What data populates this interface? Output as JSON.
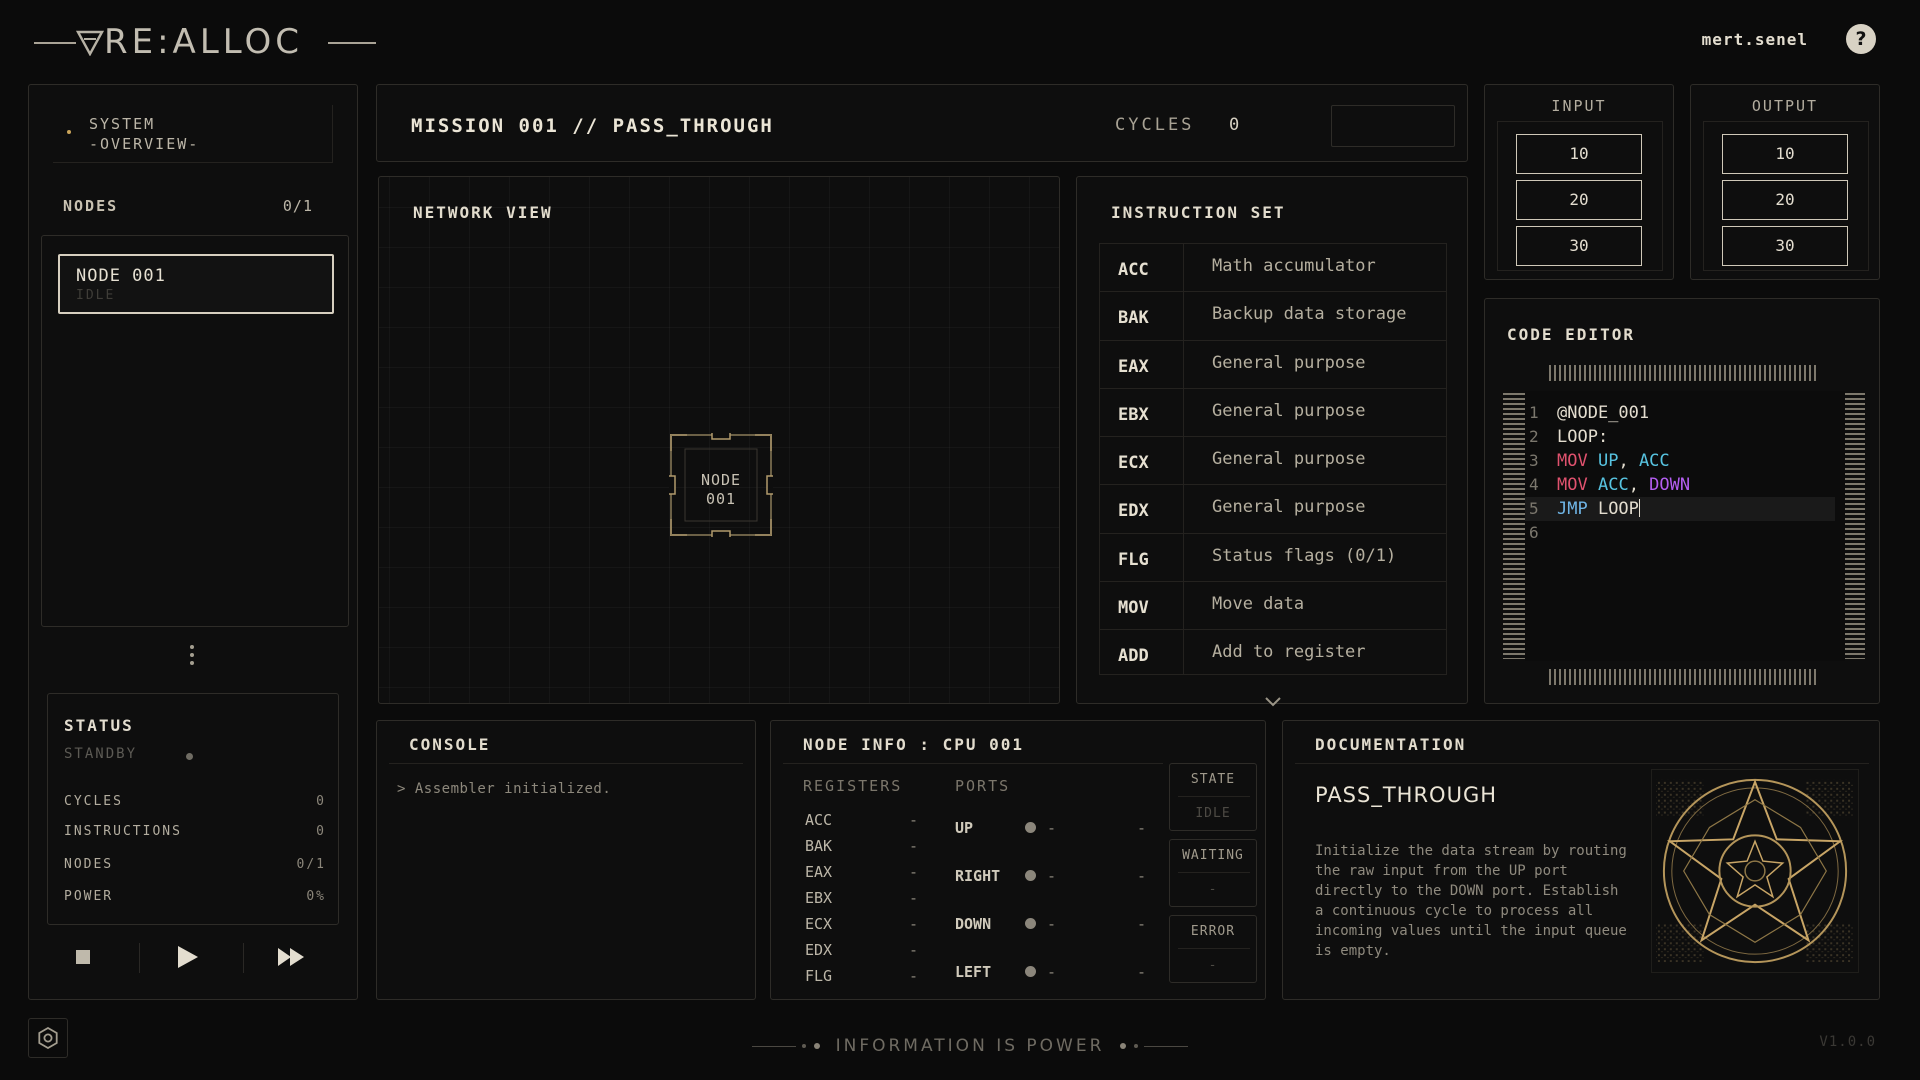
{
  "app": {
    "name": "RE:ALLOC",
    "username": "mert.senel",
    "help_label": "?"
  },
  "sidebar": {
    "system_tab": {
      "line1": "SYSTEM",
      "line2": "-OVERVIEW-"
    },
    "nodes_header": "NODES",
    "nodes_count": "0/1",
    "node_items": [
      {
        "name": "NODE 001",
        "state": "IDLE"
      }
    ],
    "status": {
      "title": "STATUS",
      "state": "STANDBY",
      "rows": [
        {
          "label": "CYCLES",
          "value": "0"
        },
        {
          "label": "INSTRUCTIONS",
          "value": "0"
        },
        {
          "label": "NODES",
          "value": "0/1"
        },
        {
          "label": "POWER",
          "value": "0%"
        }
      ]
    },
    "controls": [
      "stop-icon",
      "play-icon",
      "fast-forward-icon"
    ]
  },
  "mission": {
    "title": "MISSION 001 // PASS_THROUGH",
    "cycles_label": "CYCLES",
    "cycles_value": "0"
  },
  "network": {
    "title": "NETWORK VIEW",
    "node_label_line1": "NODE",
    "node_label_line2": "001"
  },
  "instruction_set": {
    "title": "INSTRUCTION SET",
    "rows": [
      {
        "op": "ACC",
        "desc": "Math accumulator"
      },
      {
        "op": "BAK",
        "desc": "Backup data storage"
      },
      {
        "op": "EAX",
        "desc": "General purpose"
      },
      {
        "op": "EBX",
        "desc": "General purpose"
      },
      {
        "op": "ECX",
        "desc": "General purpose"
      },
      {
        "op": "EDX",
        "desc": "General purpose"
      },
      {
        "op": "FLG",
        "desc": "Status flags (0/1)"
      },
      {
        "op": "MOV",
        "desc": "Move data"
      },
      {
        "op": "ADD",
        "desc": "Add to register"
      }
    ]
  },
  "io": {
    "input_title": "INPUT",
    "output_title": "OUTPUT",
    "input_values": [
      "10",
      "20",
      "30"
    ],
    "output_values": [
      "10",
      "20",
      "30"
    ]
  },
  "code_editor": {
    "title": "CODE EDITOR",
    "line_numbers": [
      "1",
      "2",
      "3",
      "4",
      "5",
      "6"
    ],
    "tokens": {
      "l1": "@NODE_001",
      "l2": "LOOP:",
      "l3_op": "MOV",
      "l3_a": "UP",
      "l3_sep": ", ",
      "l3_b": "ACC",
      "l4_op": "MOV",
      "l4_a": "ACC",
      "l4_sep": ", ",
      "l4_b": "DOWN",
      "l5_op": "JMP",
      "l5_a": " LOOP"
    },
    "colors": {
      "opcode": "#e0526e",
      "register": "#57c3e0",
      "port": "#b35ef0",
      "jump": "#6fb5e6"
    }
  },
  "console": {
    "title": "CONSOLE",
    "lines": [
      "> Assembler initialized."
    ]
  },
  "node_info": {
    "title": "NODE INFO : CPU 001",
    "registers_header": "REGISTERS",
    "ports_header": "PORTS",
    "registers": [
      {
        "name": "ACC",
        "value": "-"
      },
      {
        "name": "BAK",
        "value": "-"
      },
      {
        "name": "EAX",
        "value": "-"
      },
      {
        "name": "EBX",
        "value": "-"
      },
      {
        "name": "ECX",
        "value": "-"
      },
      {
        "name": "EDX",
        "value": "-"
      },
      {
        "name": "FLG",
        "value": "-"
      }
    ],
    "ports": [
      {
        "name": "UP",
        "v1": "-",
        "v2": "-"
      },
      {
        "name": "RIGHT",
        "v1": "-",
        "v2": "-"
      },
      {
        "name": "DOWN",
        "v1": "-",
        "v2": "-"
      },
      {
        "name": "LEFT",
        "v1": "-",
        "v2": "-"
      }
    ],
    "state": {
      "label": "STATE",
      "value": "IDLE"
    },
    "waiting": {
      "label": "WAITING",
      "value": "-"
    },
    "error": {
      "label": "ERROR",
      "value": "-"
    }
  },
  "documentation": {
    "title": "DOCUMENTATION",
    "heading": "PASS_THROUGH",
    "body": "Initialize the data stream by routing the raw input from the UP port directly to the DOWN port. Establish a continuous cycle to process all incoming values until the input queue is empty."
  },
  "footer": {
    "tagline": "INFORMATION IS POWER",
    "version": "V1.0.0"
  },
  "theme": {
    "accent": "#c9a45a",
    "background": "#0b0b0b",
    "panel_border": "#2e2c28"
  }
}
